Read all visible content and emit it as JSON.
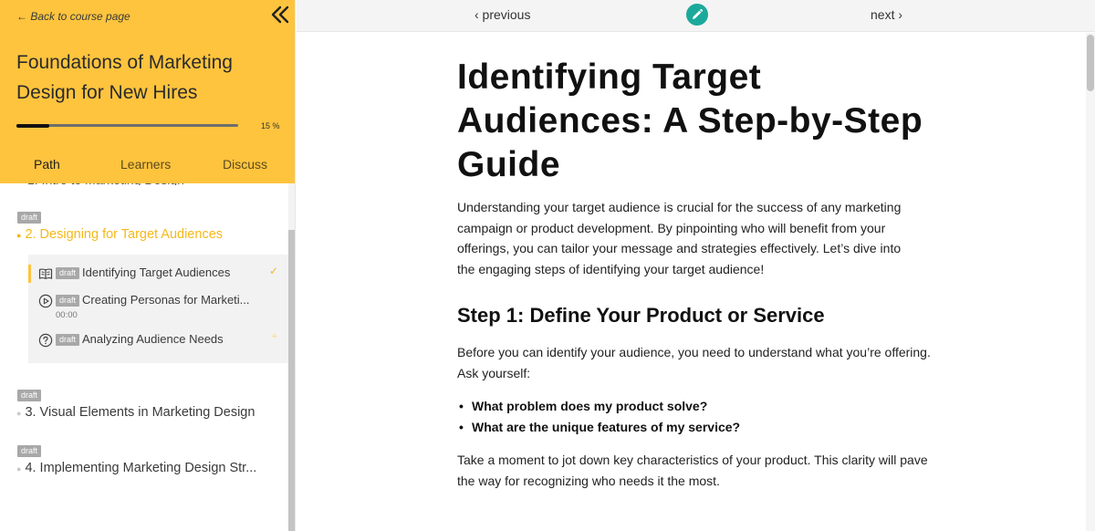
{
  "sidebar": {
    "back_label": "← Back to course page",
    "course_title": "Foundations of Marketing Design for New Hires",
    "progress": {
      "value": 15,
      "label": "15 %"
    },
    "tabs": [
      {
        "label": "Path",
        "active": true
      },
      {
        "label": "Learners",
        "active": false
      },
      {
        "label": "Discuss",
        "active": false
      }
    ],
    "sections": [
      {
        "badge": "draft",
        "title": "2. Designing for Target Audiences",
        "current": true
      },
      {
        "badge": "draft",
        "title": "3. Visual Elements in Marketing Design",
        "current": false
      },
      {
        "badge": "draft",
        "title": "4. Implementing Marketing Design Str...",
        "current": false
      }
    ],
    "lessons": [
      {
        "icon": "book-icon",
        "badge": "draft",
        "label": "Identifying Target Audiences",
        "status": "✓",
        "active": true
      },
      {
        "icon": "play-circle-icon",
        "badge": "draft",
        "label": "Creating Personas for Marketi...",
        "duration": "00:00"
      },
      {
        "icon": "quiz-question-icon",
        "badge": "draft",
        "label": "Analyzing Audience Needs",
        "status": "+"
      }
    ]
  },
  "topbar": {
    "prev_label": "‹ previous",
    "next_label": "next ›",
    "edit_icon": "pencil-icon",
    "edit_color": "#1ba99b"
  },
  "colors": {
    "accent": "#fec43e",
    "accent_text": "#f5b818"
  },
  "article": {
    "title": "Identifying Target Audiences: A Step-by-Step Guide",
    "intro": "Understanding your target audience is crucial for the success of any marketing campaign or product development. By pinpointing who will benefit from your offerings, you can tailor your message and strategies effectively. Let’s dive into the engaging steps of identifying your target audience!",
    "step1_heading": "Step 1: Define Your Product or Service",
    "step1_text": "Before you can identify your audience, you need to understand what you’re offering. Ask yourself:",
    "questions": [
      "What problem does my product solve?",
      "What are the unique features of my service?"
    ],
    "step1_followup": "Take a moment to jot down key characteristics of your product. This clarity will pave the way for recognizing who needs it the most."
  }
}
